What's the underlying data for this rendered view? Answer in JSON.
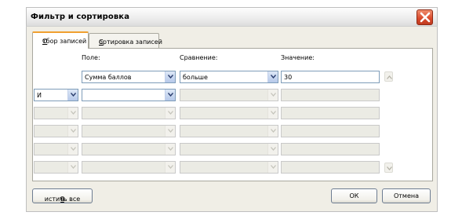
{
  "dialog": {
    "title": "Фильтр и сортировка",
    "close_icon": "close-icon",
    "accent_close": "#d9482a"
  },
  "tabs": [
    {
      "label_prefix": "",
      "hotkey": "О",
      "label_rest": "тбор записей",
      "active": true
    },
    {
      "label_prefix": "",
      "hotkey": "С",
      "label_rest": "ортировка записей",
      "active": false
    }
  ],
  "columns": {
    "field": "Поле:",
    "comparison": "Сравнение:",
    "value": "Значение:"
  },
  "rows": [
    {
      "logic": "",
      "field": "Сумма баллов",
      "comparison": "больше",
      "value": "30",
      "enabled": true
    },
    {
      "logic": "И",
      "field": "",
      "comparison": "",
      "value": "",
      "enabled": true
    },
    {
      "logic": "",
      "field": "",
      "comparison": "",
      "value": "",
      "enabled": false
    },
    {
      "logic": "",
      "field": "",
      "comparison": "",
      "value": "",
      "enabled": false
    },
    {
      "logic": "",
      "field": "",
      "comparison": "",
      "value": "",
      "enabled": false
    },
    {
      "logic": "",
      "field": "",
      "comparison": "",
      "value": "",
      "enabled": false
    }
  ],
  "buttons": {
    "clear_hotkey": "ч",
    "clear_pre": "О",
    "clear_rest": "истить все",
    "ok": "ОК",
    "cancel": "Отмена"
  }
}
